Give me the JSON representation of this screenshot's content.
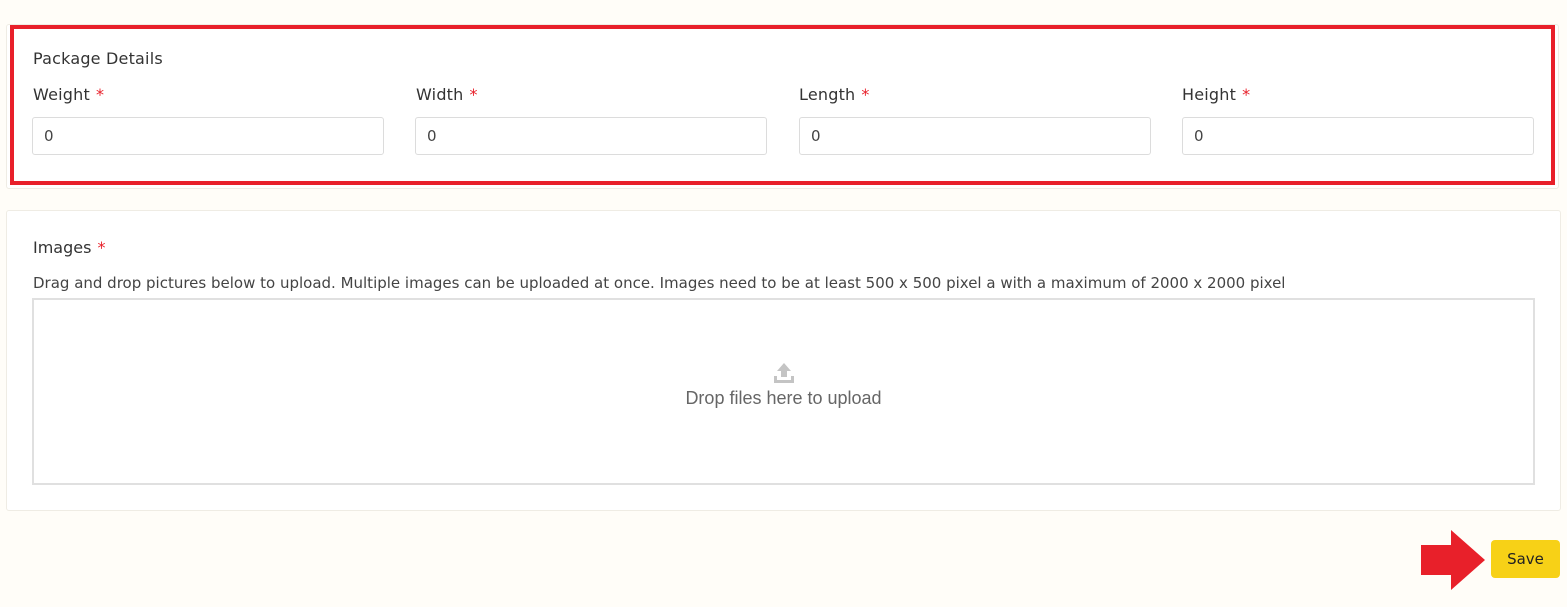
{
  "package": {
    "title": "Package Details",
    "required_marker": "*",
    "fields": [
      {
        "label": "Weight",
        "value": "0"
      },
      {
        "label": "Width",
        "value": "0"
      },
      {
        "label": "Length",
        "value": "0"
      },
      {
        "label": "Height",
        "value": "0"
      }
    ]
  },
  "images": {
    "title": "Images",
    "required_marker": "*",
    "description": "Drag and drop pictures below to upload. Multiple images can be uploaded at once. Images need to be at least 500 x 500 pixel a with a maximum of 2000 x 2000 pixel",
    "dropzone_text": "Drop files here to upload",
    "dropzone_icon": "upload-icon"
  },
  "actions": {
    "save_label": "Save",
    "save_color": "#f7d117",
    "annotation_color": "#e8202a"
  }
}
